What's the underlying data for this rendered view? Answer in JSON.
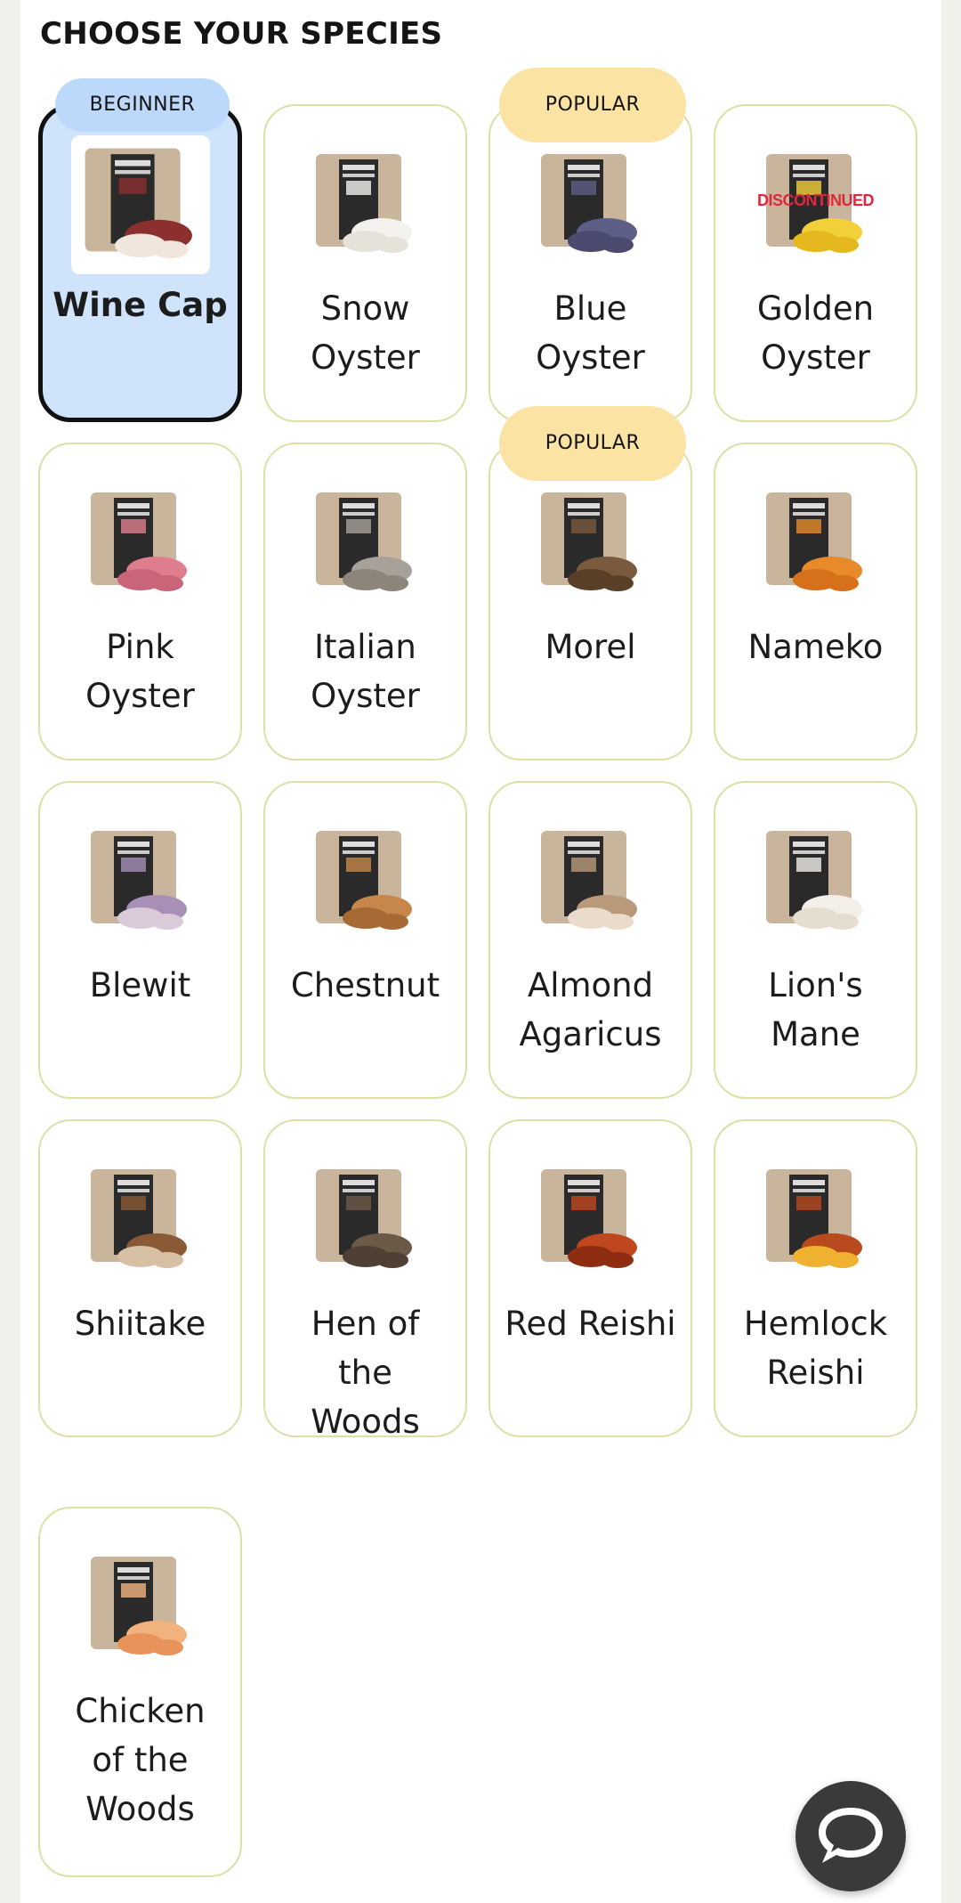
{
  "heading": "CHOOSE YOUR SPECIES",
  "badges": {
    "beginner": "BEGINNER",
    "popular": "POPULAR"
  },
  "species": [
    {
      "name": "Wine Cap",
      "selected": true,
      "badge": "BEGINNER",
      "colors": [
        "#8b2f2f",
        "#f0e6dc"
      ]
    },
    {
      "name": "Snow\nOyster",
      "colors": [
        "#f4f2ef",
        "#e6e2da"
      ]
    },
    {
      "name": "Blue\nOyster",
      "badge": "POPULAR",
      "colors": [
        "#5e5f86",
        "#4a4b6e"
      ]
    },
    {
      "name": "Golden\nOyster",
      "overlay": "DISCONTINUED",
      "colors": [
        "#f2d03a",
        "#e6b820"
      ]
    },
    {
      "name": "Pink\nOyster",
      "colors": [
        "#de7d8e",
        "#c96578"
      ]
    },
    {
      "name": "Italian\nOyster",
      "colors": [
        "#a8a19a",
        "#8d857c"
      ]
    },
    {
      "name": "Morel",
      "badge": "POPULAR",
      "colors": [
        "#7a5a3c",
        "#5a3f28"
      ]
    },
    {
      "name": "Nameko",
      "colors": [
        "#e8892a",
        "#d6701a"
      ]
    },
    {
      "name": "Blewit",
      "colors": [
        "#a88fb8",
        "#d9ccd8"
      ]
    },
    {
      "name": "Chestnut",
      "colors": [
        "#c7874a",
        "#a86a34"
      ]
    },
    {
      "name": "Almond\nAgaricus",
      "colors": [
        "#b89a7a",
        "#e9dccb"
      ]
    },
    {
      "name": "Lion's\nMane",
      "colors": [
        "#f3efe8",
        "#e4ddd0"
      ]
    },
    {
      "name": "Shiitake",
      "colors": [
        "#8a5a36",
        "#d8c0a4"
      ]
    },
    {
      "name": "Hen of\nthe\nWoods",
      "colors": [
        "#6b5a48",
        "#4e4034"
      ]
    },
    {
      "name": "Red Reishi",
      "colors": [
        "#c0461e",
        "#8e2d12"
      ]
    },
    {
      "name": "Hemlock\nReishi",
      "colors": [
        "#b84a1e",
        "#f0b030"
      ]
    },
    {
      "name": "Chicken\nof the\nWoods",
      "colors": [
        "#f2b27e",
        "#e8935a"
      ]
    }
  ],
  "chat_button": {
    "icon": "chat-bubble-icon"
  }
}
